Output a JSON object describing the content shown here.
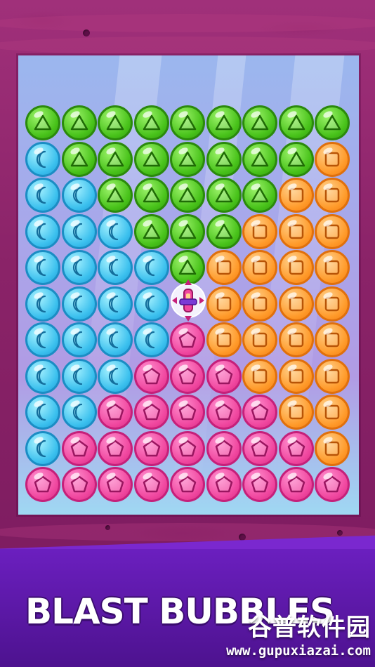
{
  "title": "BLAST BUBBLES",
  "watermark": {
    "text": "谷普软件园",
    "url": "www.gupuxiazai.com"
  },
  "colors": {
    "green": "#48c21a",
    "blue": "#3bc0ee",
    "orange": "#ff9a2a",
    "pink": "#f0479f"
  },
  "bubble_types": {
    "G": {
      "color": "green",
      "icon": "triangle-icon"
    },
    "B": {
      "color": "blue",
      "icon": "crescent-moon-icon"
    },
    "O": {
      "color": "orange",
      "icon": "square-icon"
    },
    "P": {
      "color": "pink",
      "icon": "pentagon-icon"
    }
  },
  "grid": [
    "GGGGGGGGG",
    "BGGGGGGGO",
    "BBGGGGGOO",
    "BBBGGGOOO",
    "BBBBGOOOO",
    "BBBB.OOOO",
    "BBBBPOOOO",
    "BBBPPPOOO",
    "BBPPPPPOO",
    "BPPPPPPPO",
    "PPPPPPPPP"
  ],
  "booster": {
    "icon": "rocket-booster-icon",
    "row": 5,
    "col": 4
  }
}
